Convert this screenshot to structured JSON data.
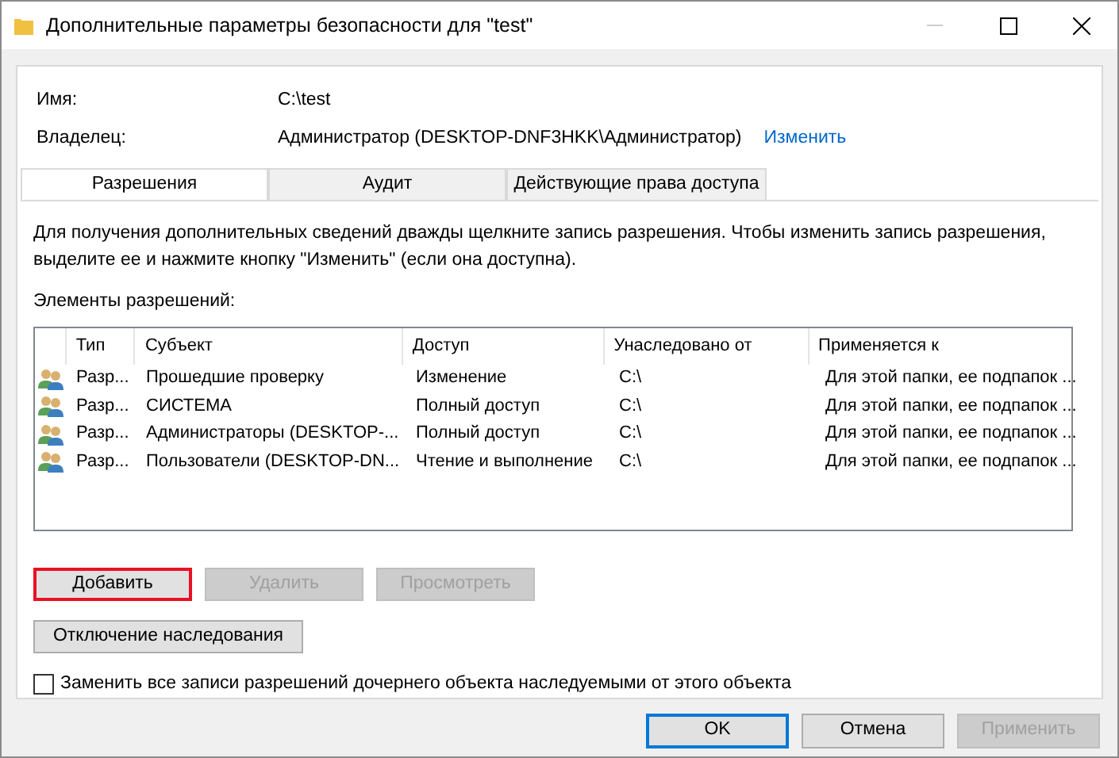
{
  "window": {
    "title": "Дополнительные параметры безопасности  для \"test\""
  },
  "fields": [
    {
      "label": "Имя:",
      "value": "C:\\test"
    },
    {
      "label": "Владелец:",
      "value": "Администратор (DESKTOP-DNF3HKK\\Администратор)",
      "link": "Изменить"
    }
  ],
  "tabs": [
    {
      "label": "Разрешения",
      "selected": true
    },
    {
      "label": "Аудит",
      "selected": false
    },
    {
      "label": "Действующие права доступа",
      "selected": false
    }
  ],
  "description": "Для получения дополнительных сведений дважды щелкните запись разрешения. Чтобы изменить запись разрешения, выделите ее и нажмите кнопку \"Изменить\" (если она доступна).",
  "list_label": "Элементы разрешений:",
  "table": {
    "columns": [
      "Тип",
      "Субъект",
      "Доступ",
      "Унаследовано от",
      "Применяется к"
    ],
    "rows": [
      {
        "cells": [
          "Разр...",
          "Прошедшие проверку",
          "Изменение",
          "C:\\",
          "Для этой папки, ее подпапок ..."
        ],
        "selected": false
      },
      {
        "cells": [
          "Разр...",
          "СИСТЕМА",
          "Полный доступ",
          "C:\\",
          "Для этой папки, ее подпапок ..."
        ],
        "selected": false
      },
      {
        "cells": [
          "Разр...",
          "Администраторы (DESKTOP-...",
          "Полный доступ",
          "C:\\",
          "Для этой папки, ее подпапок ..."
        ],
        "selected": false
      },
      {
        "cells": [
          "Разр...",
          "Пользователи (DESKTOP-DN...",
          "Чтение и выполнение",
          "C:\\",
          "Для этой папки, ее подпапок ..."
        ],
        "selected": false
      }
    ]
  },
  "action_buttons": [
    {
      "label": "Добавить",
      "disabled": false,
      "highlighted": true
    },
    {
      "label": "Удалить",
      "disabled": true,
      "highlighted": false
    },
    {
      "label": "Просмотреть",
      "disabled": true,
      "highlighted": false
    }
  ],
  "inheritance_button": {
    "label": "Отключение наследования"
  },
  "replace_checkbox": {
    "label": "Заменить все записи разрешений дочернего объекта наследуемыми от этого объекта",
    "checked": false
  },
  "dialog_buttons": [
    {
      "label": "OK",
      "disabled": false,
      "default": true
    },
    {
      "label": "Отмена",
      "disabled": false,
      "default": false
    },
    {
      "label": "Применить",
      "disabled": true,
      "default": false
    }
  ]
}
